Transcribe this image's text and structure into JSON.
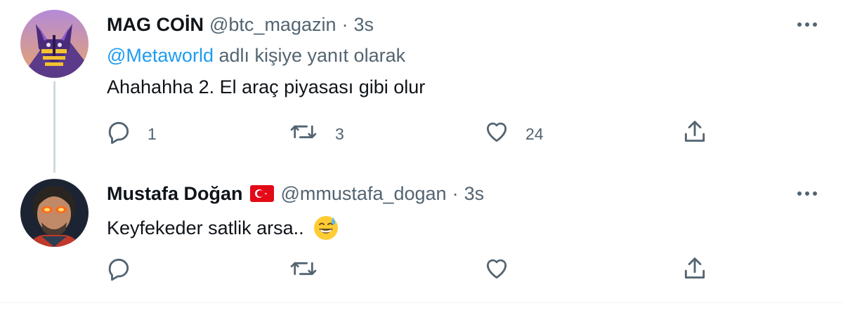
{
  "tweets": [
    {
      "name": "MAG COİN",
      "handle": "@btc_magazin",
      "separator": "·",
      "time": "3s",
      "reply_mention": "@Metaworld",
      "reply_suffix": " adlı kişiye yanıt olarak",
      "text": "Ahahahha 2. El araç piyasası gibi olur",
      "reply_count": "1",
      "retweet_count": "3",
      "like_count": "24"
    },
    {
      "name": "Mustafa Doğan",
      "handle": "@mmustafa_dogan",
      "separator": "·",
      "time": "3s",
      "text": "Keyfekeder satlik arsa..",
      "emoji": "grinning-face-with-sweat",
      "flag": "turkey-flag",
      "reply_count": "",
      "retweet_count": "",
      "like_count": ""
    }
  ],
  "colors": {
    "text": "#0f1419",
    "secondary": "#536471",
    "link": "#1d9bf0",
    "thread_line": "#cfd9de",
    "flag_red": "#e30a17"
  },
  "icons": [
    "more-icon",
    "reply-icon",
    "retweet-icon",
    "like-icon",
    "share-icon"
  ]
}
